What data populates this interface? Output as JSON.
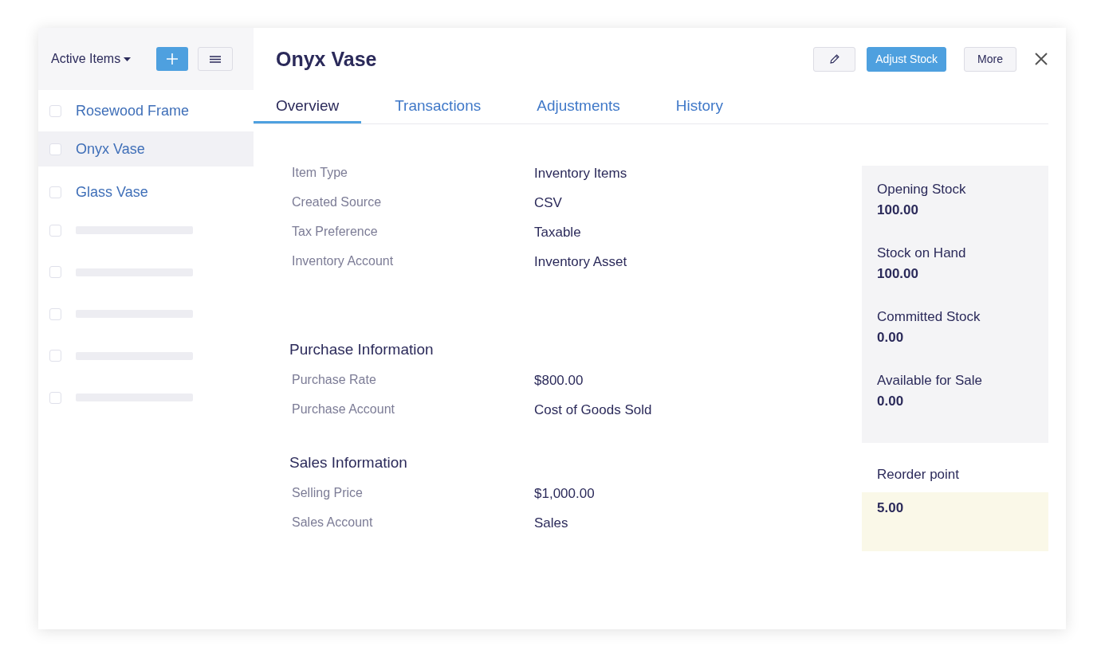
{
  "sidebar": {
    "filter": "Active Items",
    "items": [
      {
        "name": "Rosewood Frame",
        "selected": false,
        "checked": false
      },
      {
        "name": "Onyx Vase",
        "selected": true,
        "checked": false
      },
      {
        "name": "Glass Vase",
        "selected": false,
        "checked": false
      }
    ],
    "placeholder_rows": [
      {
        "checked": false
      },
      {
        "checked": false
      },
      {
        "checked": false
      },
      {
        "checked": false
      },
      {
        "checked": false
      }
    ]
  },
  "item": {
    "title": "Onyx Vase",
    "buttons": [
      "Adjust Stock",
      "More"
    ]
  },
  "tabs": [
    {
      "label": "Overview",
      "selected": true
    },
    {
      "label": "Transactions",
      "selected": false
    },
    {
      "label": "Adjustments",
      "selected": false
    },
    {
      "label": "History",
      "selected": false
    }
  ],
  "sections": [
    {
      "fields": [
        {
          "label": "Item Type",
          "value": "Inventory Items"
        },
        {
          "label": "Created Source",
          "value": "CSV"
        },
        {
          "label": "Tax Preference",
          "value": "Taxable"
        },
        {
          "label": "Inventory Account",
          "value": "Inventory Asset"
        }
      ]
    },
    {
      "heading": "Purchase Information",
      "fields": [
        {
          "label": "Purchase Rate",
          "value": "$800.00"
        },
        {
          "label": "Purchase Account",
          "value": "Cost of Goods Sold"
        }
      ]
    },
    {
      "heading": "Sales Information",
      "fields": [
        {
          "label": "Selling Price",
          "value": "$1,000.00"
        },
        {
          "label": "Sales Account",
          "value": "Sales"
        }
      ]
    }
  ],
  "stock": [
    {
      "label": "Opening Stock",
      "value": "100.00"
    },
    {
      "label": "Stock on Hand",
      "value": "100.00"
    },
    {
      "label": "Committed Stock",
      "value": "0.00"
    },
    {
      "label": "Available for Sale",
      "value": "0.00"
    }
  ],
  "reorder": {
    "label": "Reorder point",
    "value": "5.00"
  }
}
